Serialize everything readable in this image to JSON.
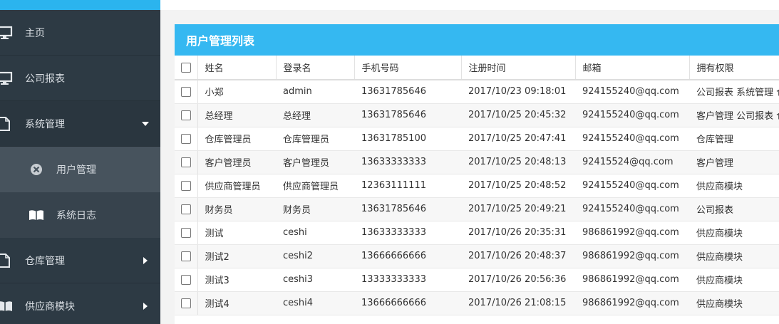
{
  "sidebar": {
    "items": [
      {
        "label": "主页",
        "icon": "monitor-icon"
      },
      {
        "label": "公司报表",
        "icon": "monitor-icon"
      },
      {
        "label": "系统管理",
        "icon": "file-icon",
        "expanded": true
      },
      {
        "label": "仓库管理",
        "icon": "file-icon"
      },
      {
        "label": "供应商模块",
        "icon": "book-icon"
      }
    ],
    "subitems": [
      {
        "label": "用户管理",
        "icon": "close-circle-icon",
        "active": true
      },
      {
        "label": "系统日志",
        "icon": "book-icon"
      }
    ]
  },
  "colors": {
    "accent": "#35b8f1",
    "sidebar_bg": "#2d3a44"
  },
  "panel": {
    "title": "用户管理列表"
  },
  "table": {
    "columns": [
      "姓名",
      "登录名",
      "手机号码",
      "注册时间",
      "邮箱",
      "拥有权限"
    ],
    "rows": [
      [
        "小郑",
        "admin",
        "13631785646",
        "2017/10/23 09:18:01",
        "924155240@qq.com",
        "公司报表 系统管理 仓"
      ],
      [
        "总经理",
        "总经理",
        "13631785646",
        "2017/10/25 20:45:32",
        "924155240@qq.com",
        "客户管理 公司报表 仓"
      ],
      [
        "仓库管理员",
        "仓库管理员",
        "13631785100",
        "2017/10/25 20:47:41",
        "924155240@qq.com",
        "仓库管理"
      ],
      [
        "客户管理员",
        "客户管理员",
        "13633333333",
        "2017/10/25 20:48:13",
        "92415524@qq.com",
        "客户管理"
      ],
      [
        "供应商管理员",
        "供应商管理员",
        "12363111111",
        "2017/10/25 20:48:52",
        "924155240@qq.com",
        "供应商模块"
      ],
      [
        "财务员",
        "财务员",
        "13631785646",
        "2017/10/25 20:49:21",
        "924155240@qq.com",
        "公司报表"
      ],
      [
        "测试",
        "ceshi",
        "13633333333",
        "2017/10/26 20:35:31",
        "986861992@qq.com",
        "供应商模块"
      ],
      [
        "测试2",
        "ceshi2",
        "13666666666",
        "2017/10/26 20:48:37",
        "986861992@qq.com",
        "供应商模块"
      ],
      [
        "测试3",
        "ceshi3",
        "13333333333",
        "2017/10/26 20:56:36",
        "986861992@qq.com",
        "供应商模块"
      ],
      [
        "测试4",
        "ceshi4",
        "13666666666",
        "2017/10/26 21:08:15",
        "986861992@qq.com",
        "供应商模块"
      ]
    ]
  }
}
